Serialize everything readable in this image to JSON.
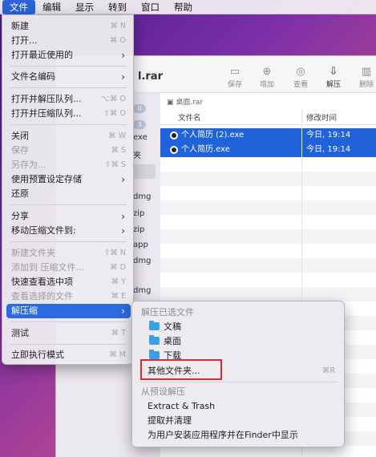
{
  "menubar": [
    "文件",
    "编辑",
    "显示",
    "转到",
    "窗口",
    "帮助"
  ],
  "window": {
    "title": "l.rar",
    "toolbar": [
      {
        "label": "保存",
        "icon": "save-icon"
      },
      {
        "label": "增加",
        "icon": "add-icon"
      },
      {
        "label": "查看",
        "icon": "view-icon"
      },
      {
        "label": "解压",
        "icon": "extract-icon"
      },
      {
        "label": "删除",
        "icon": "delete-icon"
      }
    ],
    "sidebar": {
      "badge1": "0",
      "badge2": "3",
      "items": [
        "exe",
        "夹",
        "dmg",
        "zip",
        "zip",
        "app",
        "dmg",
        "dmg"
      ]
    },
    "path": "桌面.rar",
    "columns": {
      "name": "文件名",
      "date": "修改时间"
    },
    "files": [
      {
        "name": "个人简历 (2).exe",
        "date": "今日, 19:14"
      },
      {
        "name": "个人简历.exe",
        "date": "今日, 19:14"
      }
    ]
  },
  "file_menu": [
    {
      "label": "新建",
      "shortcut": "⌘ N"
    },
    {
      "label": "打开...",
      "shortcut": "⌘ O"
    },
    {
      "label": "打开最近使用的",
      "arrow": "›"
    },
    {
      "label": "文件名编码",
      "arrow": "›"
    },
    {
      "label": "打开并解压队列...",
      "shortcut": "⌥⌘ O"
    },
    {
      "label": "打开并压缩队列...",
      "shortcut": "⇧⌘ O"
    },
    {
      "label": "关闭",
      "shortcut": "⌘ W"
    },
    {
      "label": "保存",
      "shortcut": "⌘ S",
      "disabled": true
    },
    {
      "label": "另存为...",
      "shortcut": "⇧⌘ S",
      "disabled": true
    },
    {
      "label": "使用预置设定存储",
      "arrow": "›"
    },
    {
      "label": "还原"
    },
    {
      "label": "分享",
      "arrow": "›"
    },
    {
      "label": "移动压缩文件到:",
      "arrow": "›"
    },
    {
      "label": "新建文件夹",
      "shortcut": "⇧⌘ N",
      "disabled": true
    },
    {
      "label": "添加到 压缩文件...",
      "shortcut": "⌘ D",
      "disabled": true
    },
    {
      "label": "快速查看选中项",
      "shortcut": "⌘ Y"
    },
    {
      "label": "查看选择的文件",
      "shortcut": "⌘ E",
      "disabled": true
    },
    {
      "label": "解压缩",
      "arrow": "›"
    },
    {
      "label": "测试",
      "shortcut": "⌘ T"
    },
    {
      "label": "立即执行模式",
      "shortcut": "⌘ M"
    }
  ],
  "sub_menu": {
    "header1": "解压已选文件",
    "folders": [
      "文稿",
      "桌面",
      "下载"
    ],
    "other": "其他文件夹...",
    "other_shortcut": "⌘R",
    "header2": "从预设解压",
    "presets": [
      "Extract & Trash",
      "提取并清理",
      "为用户安装应用程序并在Finder中显示"
    ]
  }
}
